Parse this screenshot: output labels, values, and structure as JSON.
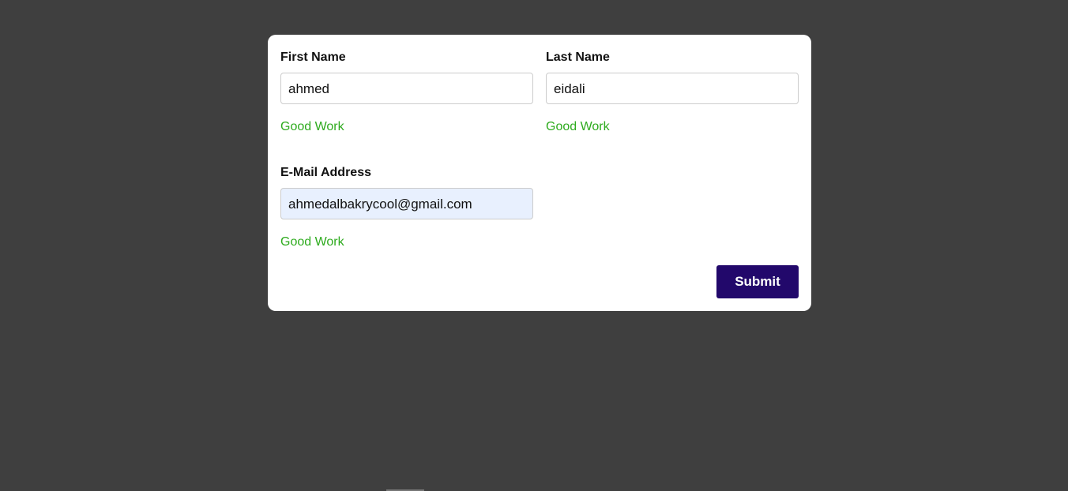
{
  "form": {
    "first_name": {
      "label": "First Name",
      "value": "ahmed",
      "message": "Good Work"
    },
    "last_name": {
      "label": "Last Name",
      "value": "eidali",
      "message": "Good Work"
    },
    "email": {
      "label": "E-Mail Address",
      "value": "ahmedalbakrycool@gmail.com",
      "message": "Good Work"
    },
    "submit_label": "Submit"
  },
  "colors": {
    "success": "#2eab1e",
    "button": "#22086b"
  }
}
